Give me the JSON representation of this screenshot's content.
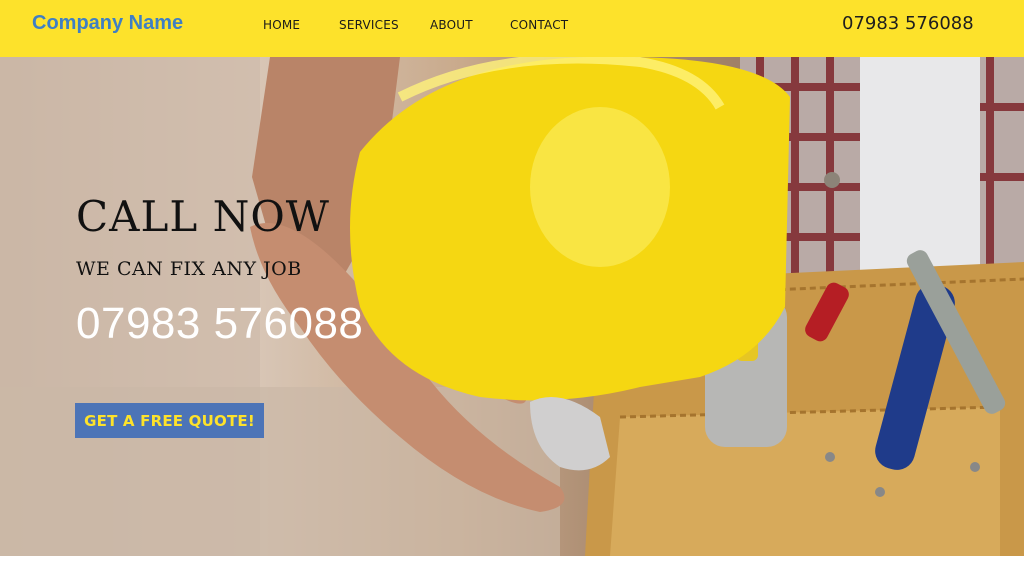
{
  "header": {
    "brand": "Company Name",
    "nav": [
      "HOME",
      "SERVICES",
      "ABOUT",
      "CONTACT"
    ],
    "phone": "07983 576088"
  },
  "hero": {
    "title": "CALL NOW",
    "subtitle": "WE CAN FIX ANY JOB",
    "phone": "07983 576088",
    "cta_label": "GET A FREE QUOTE!",
    "image_description_icons": [
      "hard-hat",
      "tool-belt",
      "hand",
      "plaid-shirt"
    ]
  },
  "colors": {
    "header_bg": "#fde22b",
    "brand": "#3f7fc4",
    "cta_bg": "#4c74b7",
    "cta_text": "#fde22b"
  }
}
